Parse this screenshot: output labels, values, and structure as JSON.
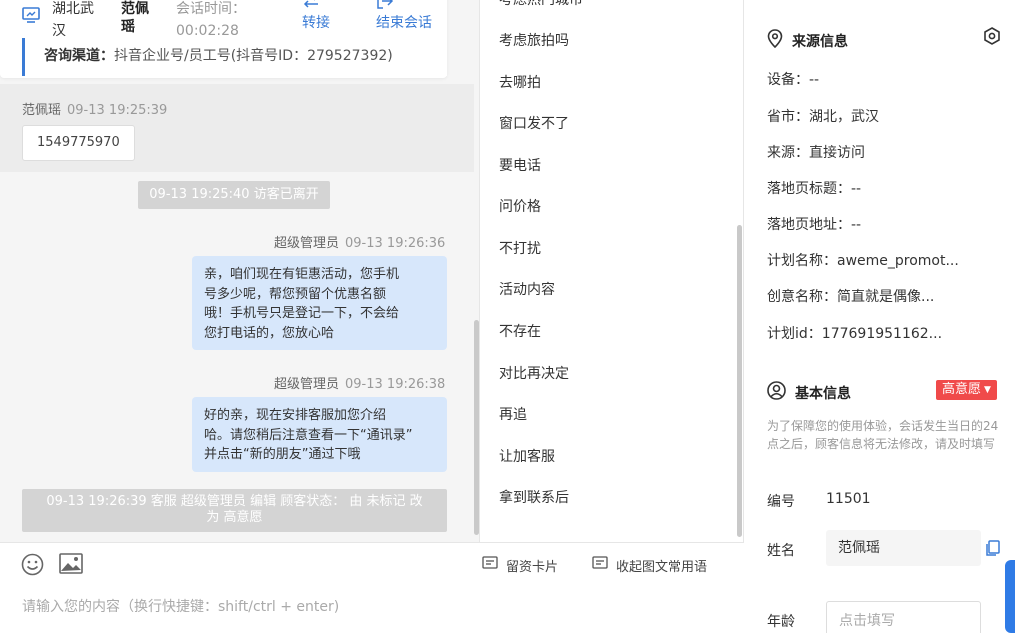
{
  "header": {
    "location": "湖北武汉",
    "visitor_name": "范佩瑶",
    "session_label": "会话时间：",
    "session_time": "00:02:28",
    "transfer_label": "转接",
    "end_label": "结束会话",
    "channel_key": "咨询渠道：",
    "channel_value": "抖音企业号/员工号(抖音号ID：279527392)"
  },
  "chat": {
    "messages": [
      {
        "sender": "范佩瑶",
        "time": "09-13 19:25:39",
        "text": "1549775970"
      },
      {
        "system": "09-13 19:25:40 访客已离开"
      },
      {
        "sender": "超级管理员",
        "time": "09-13 19:26:36",
        "text": "亲，咱们现在有钜惠活动，您手机号多少呢，帮您预留个优惠名额哦！手机号只是登记一下，不会给您打电话的，您放心哈"
      },
      {
        "sender": "超级管理员",
        "time": "09-13 19:26:38",
        "text": "好的亲，现在安排客服加您介绍哈。请您稍后注意查看一下“通讯录”并点击“新的朋友”通过下哦"
      },
      {
        "system": "09-13 19:26:39 客服 超级管理员 编辑 顾客状态： 由 未标记 改为 高意愿"
      }
    ],
    "bubble1_lines": [
      "亲，咱们现在有钜惠活动，您手机",
      "号多少呢，帮您预留个优惠名额",
      "哦！手机号只是登记一下，不会给",
      "您打电话的，您放心哈"
    ],
    "bubble2_lines": [
      "好的亲，现在安排客服加您介绍",
      "哈。请您稍后注意查看一下“通讯录”",
      "并点击“新的朋友”通过下哦"
    ],
    "sys2_lines": [
      "09-13 19:26:39 客服 超级管理员 编辑 顾客状态： 由 未标记 改",
      "为 高意愿"
    ]
  },
  "toolbar": {
    "card_label": "留资卡片",
    "collapse_label": "收起图文常用语",
    "input_placeholder": "请输入您的内容（换行快捷键：shift/ctrl + enter)"
  },
  "phrases": [
    "考虑热门城市",
    "考虑旅拍吗",
    "去哪拍",
    "窗口发不了",
    "要电话",
    "问价格",
    "不打扰",
    "活动内容",
    "不存在",
    "对比再决定",
    "再追",
    "让加客服",
    "拿到联系后"
  ],
  "source_info": {
    "title": "来源信息",
    "rows": [
      {
        "k": "设备：",
        "v": "--"
      },
      {
        "k": "省市：",
        "v": "湖北，武汉"
      },
      {
        "k": "来源：",
        "v": "直接访问"
      },
      {
        "k": "落地页标题：",
        "v": "--"
      },
      {
        "k": "落地页地址：",
        "v": "--"
      },
      {
        "k": "计划名称：",
        "v": "aweme_promot..."
      },
      {
        "k": "创意名称：",
        "v": "简直就是偶像..."
      },
      {
        "k": "计划id：",
        "v": "177691951162..."
      }
    ]
  },
  "basic_info": {
    "title": "基本信息",
    "intent_badge": "高意愿",
    "note": "为了保障您的使用体验，会话发生当日的24点之后，顾客信息将无法修改，请及时填写",
    "id_label": "编号",
    "id_value": "11501",
    "name_label": "姓名",
    "name_value": "范佩瑶",
    "age_label": "年龄",
    "age_placeholder": "点击填写"
  },
  "colors": {
    "accent": "#3a7bd5",
    "bubble": "#d7e7fb",
    "badge": "#f04a4a"
  }
}
